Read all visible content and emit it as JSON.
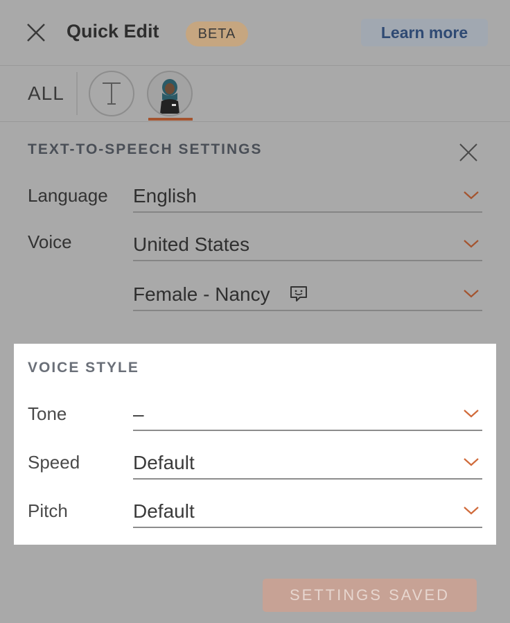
{
  "header": {
    "title": "Quick Edit",
    "badge": "BETA",
    "learn_more": "Learn more"
  },
  "tabs": {
    "all_label": "ALL",
    "text_tab_icon": "text-T-icon",
    "voice_tab_icon": "voice-avatar-icon",
    "active": "voice"
  },
  "tts": {
    "title": "TEXT-TO-SPEECH SETTINGS",
    "language_label": "Language",
    "language_value": "English",
    "voice_label": "Voice",
    "voice_region_value": "United States",
    "voice_name_value": "Female - Nancy"
  },
  "voice_style": {
    "title": "VOICE STYLE",
    "tone_label": "Tone",
    "tone_value": "–",
    "speed_label": "Speed",
    "speed_value": "Default",
    "pitch_label": "Pitch",
    "pitch_value": "Default"
  },
  "footer": {
    "saved_label": "SETTINGS SAVED"
  },
  "colors": {
    "accent": "#a4542f",
    "overlay": "#a9a9a9",
    "link": "#2f4a73"
  }
}
